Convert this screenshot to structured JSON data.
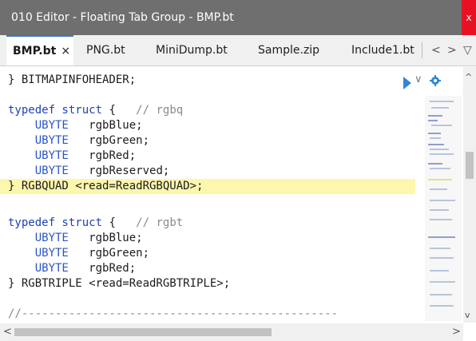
{
  "window": {
    "title": "010 Editor - Floating Tab Group - BMP.bt",
    "close_glyph": "x"
  },
  "tabs": [
    {
      "label": "BMP.bt",
      "close": "×",
      "active": true
    },
    {
      "label": "PNG.bt"
    },
    {
      "label": "MiniDump.bt"
    },
    {
      "label": "Sample.zip"
    },
    {
      "label": "Include1.bt"
    }
  ],
  "tab_nav": {
    "prev": "<",
    "next": ">",
    "menu": "▽"
  },
  "editor": {
    "lines": [
      {
        "pl": "} BITMAPINFOHEADER;"
      },
      {
        "pl": ""
      },
      {
        "kw": "typedef struct",
        "pl": " {   ",
        "cm": "// rgbq"
      },
      {
        "ind": "    ",
        "ty": "UBYTE",
        "pl": "   rgbBlue;"
      },
      {
        "ind": "    ",
        "ty": "UBYTE",
        "pl": "   rgbGreen;"
      },
      {
        "ind": "    ",
        "ty": "UBYTE",
        "pl": "   rgbRed;"
      },
      {
        "ind": "    ",
        "ty": "UBYTE",
        "pl": "   rgbReserved;"
      },
      {
        "pl": "} RGBQUAD <read=ReadRGBQUAD>;",
        "highlight": true
      },
      {
        "pl": ""
      },
      {
        "kw": "typedef struct",
        "pl": " {   ",
        "cm": "// rgbt"
      },
      {
        "ind": "    ",
        "ty": "UBYTE",
        "pl": "   rgbBlue;"
      },
      {
        "ind": "    ",
        "ty": "UBYTE",
        "pl": "   rgbGreen;"
      },
      {
        "ind": "    ",
        "ty": "UBYTE",
        "pl": "   rgbRed;"
      },
      {
        "pl": "} RGBTRIPLE <read=ReadRGBTRIPLE>;"
      },
      {
        "pl": ""
      },
      {
        "cm": "//-----------------------------------------------"
      }
    ]
  },
  "controls": {
    "dropdown": "∨",
    "settings_icon": "gear-icon",
    "scroll_up": "^",
    "scroll_down": "v",
    "scroll_left": "<",
    "scroll_right": ">"
  },
  "colors": {
    "keyword": "#1f43b5",
    "type": "#2a55c9",
    "comment": "#8a8a8a",
    "highlight": "#fdf6ad",
    "title_bar": "#6f6f6f",
    "close": "#e81123",
    "marker": "#2f86d6"
  }
}
